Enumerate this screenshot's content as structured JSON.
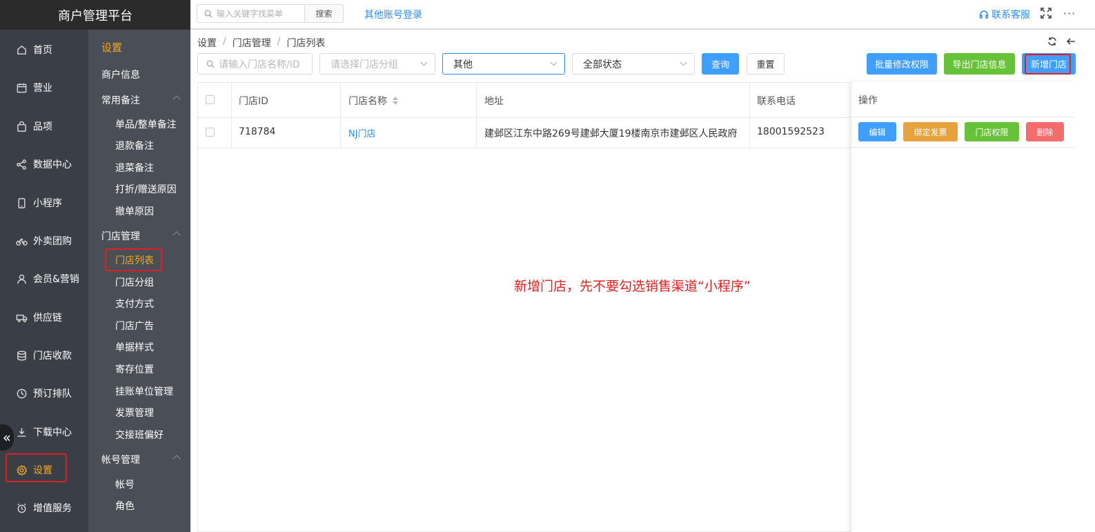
{
  "brand": "商户管理平台",
  "nav1": [
    {
      "label": "首页",
      "icon": "home-icon"
    },
    {
      "label": "营业",
      "icon": "calendar-icon"
    },
    {
      "label": "品项",
      "icon": "bag-icon"
    },
    {
      "label": "数据中心",
      "icon": "share-icon"
    },
    {
      "label": "小程序",
      "icon": "mobile-icon"
    },
    {
      "label": "外卖团购",
      "icon": "bike-icon"
    },
    {
      "label": "会员&营销",
      "icon": "user-icon"
    },
    {
      "label": "供应链",
      "icon": "truck-icon"
    },
    {
      "label": "门店收款",
      "icon": "coins-icon"
    },
    {
      "label": "预订排队",
      "icon": "clock-icon"
    },
    {
      "label": "下载中心",
      "icon": "download-icon"
    },
    {
      "label": "设置",
      "icon": "gear-icon"
    },
    {
      "label": "增值服务",
      "icon": "alarm-icon"
    }
  ],
  "nav2": {
    "title": "设置",
    "merchant_info": "商户信息",
    "group1": "常用备注",
    "group1_items": [
      "单品/整单备注",
      "退款备注",
      "退菜备注",
      "打折/赠送原因",
      "撤单原因"
    ],
    "group2": "门店管理",
    "group2_items": [
      "门店列表",
      "门店分组",
      "支付方式",
      "门店广告",
      "单据样式",
      "寄存位置",
      "挂账单位管理",
      "发票管理",
      "交接班偏好"
    ],
    "group3": "帐号管理",
    "group3_items": [
      "帐号",
      "角色"
    ]
  },
  "topbar": {
    "search_placeholder": "输入关键字找菜单",
    "search_button": "搜索",
    "other_login": "其他账号登录",
    "contact": "联系客服",
    "more": "···"
  },
  "breadcrumb": [
    "设置",
    "门店管理",
    "门店列表"
  ],
  "filters": {
    "store_placeholder": "请输入门店名称/ID",
    "group_placeholder": "请选择门店分组",
    "channel_value": "其他",
    "status_value": "全部状态",
    "query": "查询",
    "reset": "重置",
    "batch_perm": "批量修改权限",
    "export": "导出门店信息",
    "add_store": "新增门店"
  },
  "table": {
    "headers": [
      "门店ID",
      "门店名称",
      "地址",
      "联系电话",
      "操作"
    ],
    "rows": [
      {
        "id": "718784",
        "name": "NJ门店",
        "address": "建邺区江东中路269号建邺大厦19楼南京市建邺区人民政府",
        "phone": "18001592523",
        "actions": [
          "编辑",
          "绑定发票",
          "门店权限",
          "删除"
        ]
      }
    ]
  },
  "note": "新增门店，先不要勾选销售渠道“小程序”",
  "colors": {
    "accent": "#f5a623",
    "primary": "#409eff",
    "success": "#67c23a",
    "warning": "#e6a23c",
    "danger": "#f56c6c",
    "annotation": "#e02020"
  }
}
